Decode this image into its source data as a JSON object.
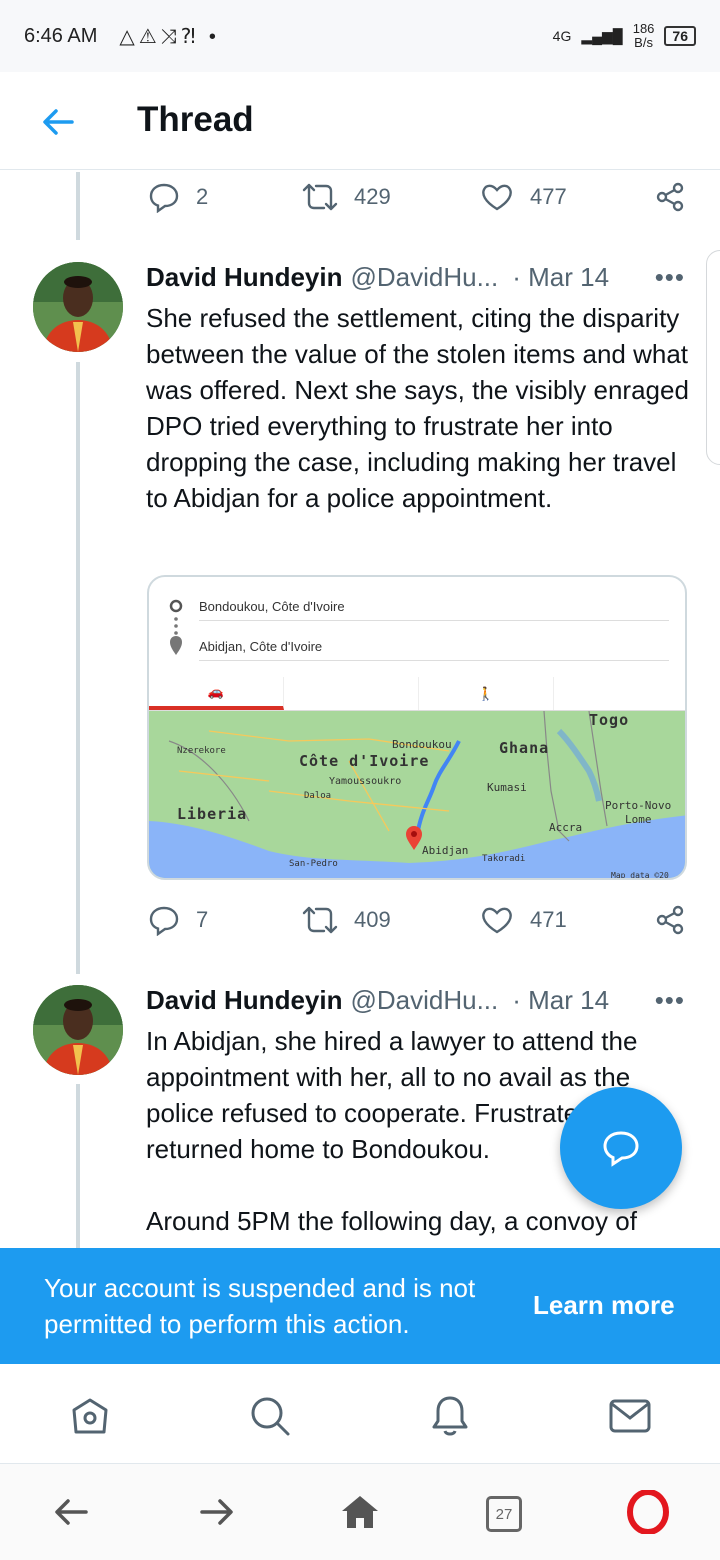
{
  "status_bar": {
    "time": "6:46 AM",
    "net_type": "4G",
    "speed_value": "186",
    "speed_unit": "B/s",
    "battery": "76"
  },
  "header": {
    "title": "Thread"
  },
  "prev_tweet_actions": {
    "replies": "2",
    "retweets": "429",
    "likes": "477"
  },
  "tweets": [
    {
      "author": "David Hundeyin",
      "handle": "@DavidHu...",
      "date": "· Mar 14",
      "text": "She refused the settlement, citing the disparity between the value of the stolen items and what was offered. Next she says, the visibly enraged DPO tried everything to frustrate her into dropping the case, including making her travel to Abidjan for a police appointment.",
      "map": {
        "origin": "Bondoukou, Côte d'Ivoire",
        "destination": "Abidjan, Côte d'Ivoire",
        "labels": {
          "togo": "Togo",
          "ghana": "Ghana",
          "cote": "Côte d'Ivoire",
          "liberia": "Liberia",
          "bondoukou": "Bondoukou",
          "nzerekore": "Nzerekore",
          "yamoussoukro": "Yamoussoukro",
          "daloa": "Daloa",
          "kumasi": "Kumasi",
          "accra": "Accra",
          "porto_novo": "Porto-Novo",
          "lome": "Lome",
          "abidjan": "Abidjan",
          "takoradi": "Takoradi",
          "san_pedro": "San-Pedro",
          "map_data": "Map data ©20"
        }
      },
      "replies": "7",
      "retweets": "409",
      "likes": "471"
    },
    {
      "author": "David Hundeyin",
      "handle": "@DavidHu...",
      "date": "· Mar 14",
      "text": "In Abidjan, she hired a lawyer to attend the appointment with her, all to no avail as the police refused to cooperate. Frustrated, she returned home to Bondoukou.\n\nAround 5PM the following day, a convoy of"
    }
  ],
  "banner": {
    "message": "Your account is suspended and is not permitted to perform this action.",
    "link": "Learn more"
  },
  "browser": {
    "tab_count": "27"
  },
  "colors": {
    "accent": "#1d9bf0",
    "text": "#0f1419",
    "muted": "#536471"
  }
}
